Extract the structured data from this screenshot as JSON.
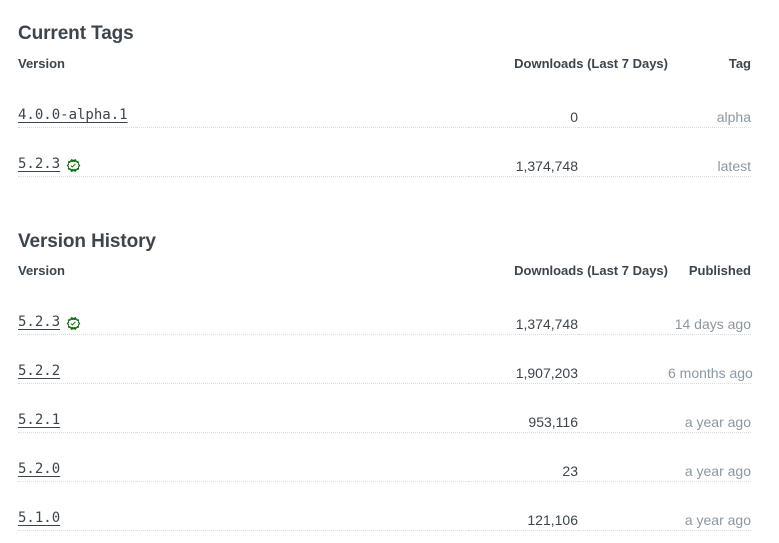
{
  "sections": {
    "current_tags": {
      "title": "Current Tags",
      "columns": {
        "version": "Version",
        "downloads": "Downloads (Last 7 Days)",
        "meta": "Tag"
      },
      "rows": [
        {
          "version": "4.0.0-alpha.1",
          "verified": false,
          "downloads": "0",
          "meta": "alpha"
        },
        {
          "version": "5.2.3",
          "verified": true,
          "downloads": "1,374,748",
          "meta": "latest"
        }
      ]
    },
    "version_history": {
      "title": "Version History",
      "columns": {
        "version": "Version",
        "downloads": "Downloads (Last 7 Days)",
        "meta": "Published"
      },
      "rows": [
        {
          "version": "5.2.3",
          "verified": true,
          "downloads": "1,374,748",
          "meta": "14 days ago"
        },
        {
          "version": "5.2.2",
          "verified": false,
          "downloads": "1,907,203",
          "meta": "6 months ago"
        },
        {
          "version": "5.2.1",
          "verified": false,
          "downloads": "953,116",
          "meta": "a year ago"
        },
        {
          "version": "5.2.0",
          "verified": false,
          "downloads": "23",
          "meta": "a year ago"
        },
        {
          "version": "5.1.0",
          "verified": false,
          "downloads": "121,106",
          "meta": "a year ago"
        }
      ]
    }
  },
  "icons": {
    "verified": "verified-badge-icon"
  },
  "colors": {
    "text": "#3b454e",
    "muted": "#8b97a2",
    "verified_green": "#107010",
    "leader_dots": "#dcdfe3",
    "background": "#ffffff"
  }
}
